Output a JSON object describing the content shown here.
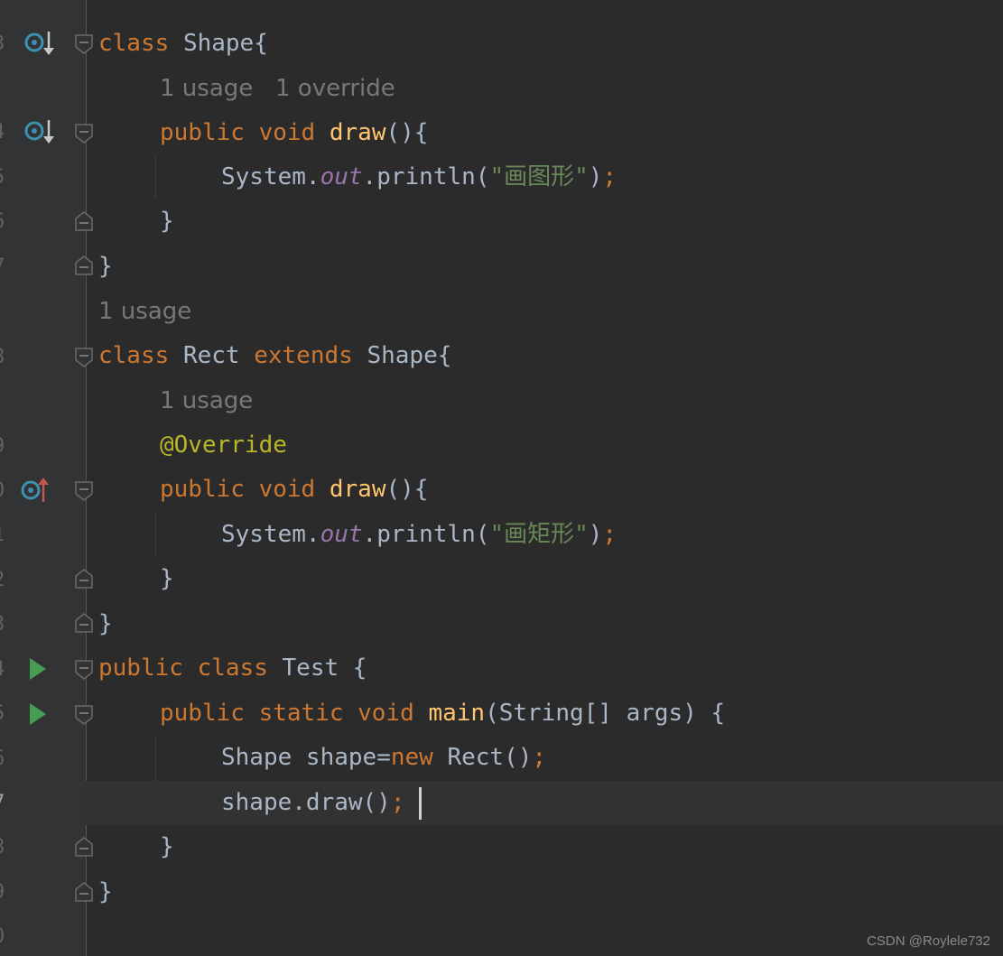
{
  "editor": {
    "language": "java",
    "line_numbers": [
      "3",
      "4",
      "5",
      "6",
      "7",
      "8",
      "9",
      "0",
      "1",
      "2",
      "3",
      "4",
      "5",
      "6",
      "7",
      "8",
      "9",
      "0"
    ],
    "current_line_number": "7",
    "hints": {
      "shape_usage": "1 usage",
      "shape_override": "1 override",
      "rect_usage": "1 usage",
      "draw_usage": "1 usage"
    },
    "tokens": {
      "class": "class",
      "public": "public",
      "void": "void",
      "static": "static",
      "extends": "extends",
      "new": "new",
      "shape_class": "Shape",
      "rect_class": "Rect",
      "test_class": "Test",
      "draw": "draw",
      "main": "main",
      "system": "System.",
      "out": "out",
      "println": ".println(",
      "str_shape": "\"画图形\"",
      "str_rect": "\"画矩形\"",
      "override": "@Override",
      "main_params": "(String[] args) {",
      "shape_decl": "Shape shape=",
      "rect_ctor": " Rect()",
      "shape_call": "shape.draw()",
      "open_brace": "{",
      "close_brace": "}",
      "parens_brace": "(){",
      "paren_close": ")",
      "semicolon": ";",
      "space_brace": " {"
    },
    "gutter_icons": {
      "implemented": "implemented-method-icon",
      "overrides": "overriding-method-icon",
      "run": "run-icon"
    },
    "colors": {
      "background": "#2b2b2b",
      "keyword": "#cc7832",
      "method": "#ffc66d",
      "field": "#9876aa",
      "string": "#6a8759",
      "annotation": "#bbb529",
      "text": "#a9b7c6",
      "hint": "#787878",
      "run": "#499c54"
    }
  },
  "watermark": "CSDN @Roylele732"
}
